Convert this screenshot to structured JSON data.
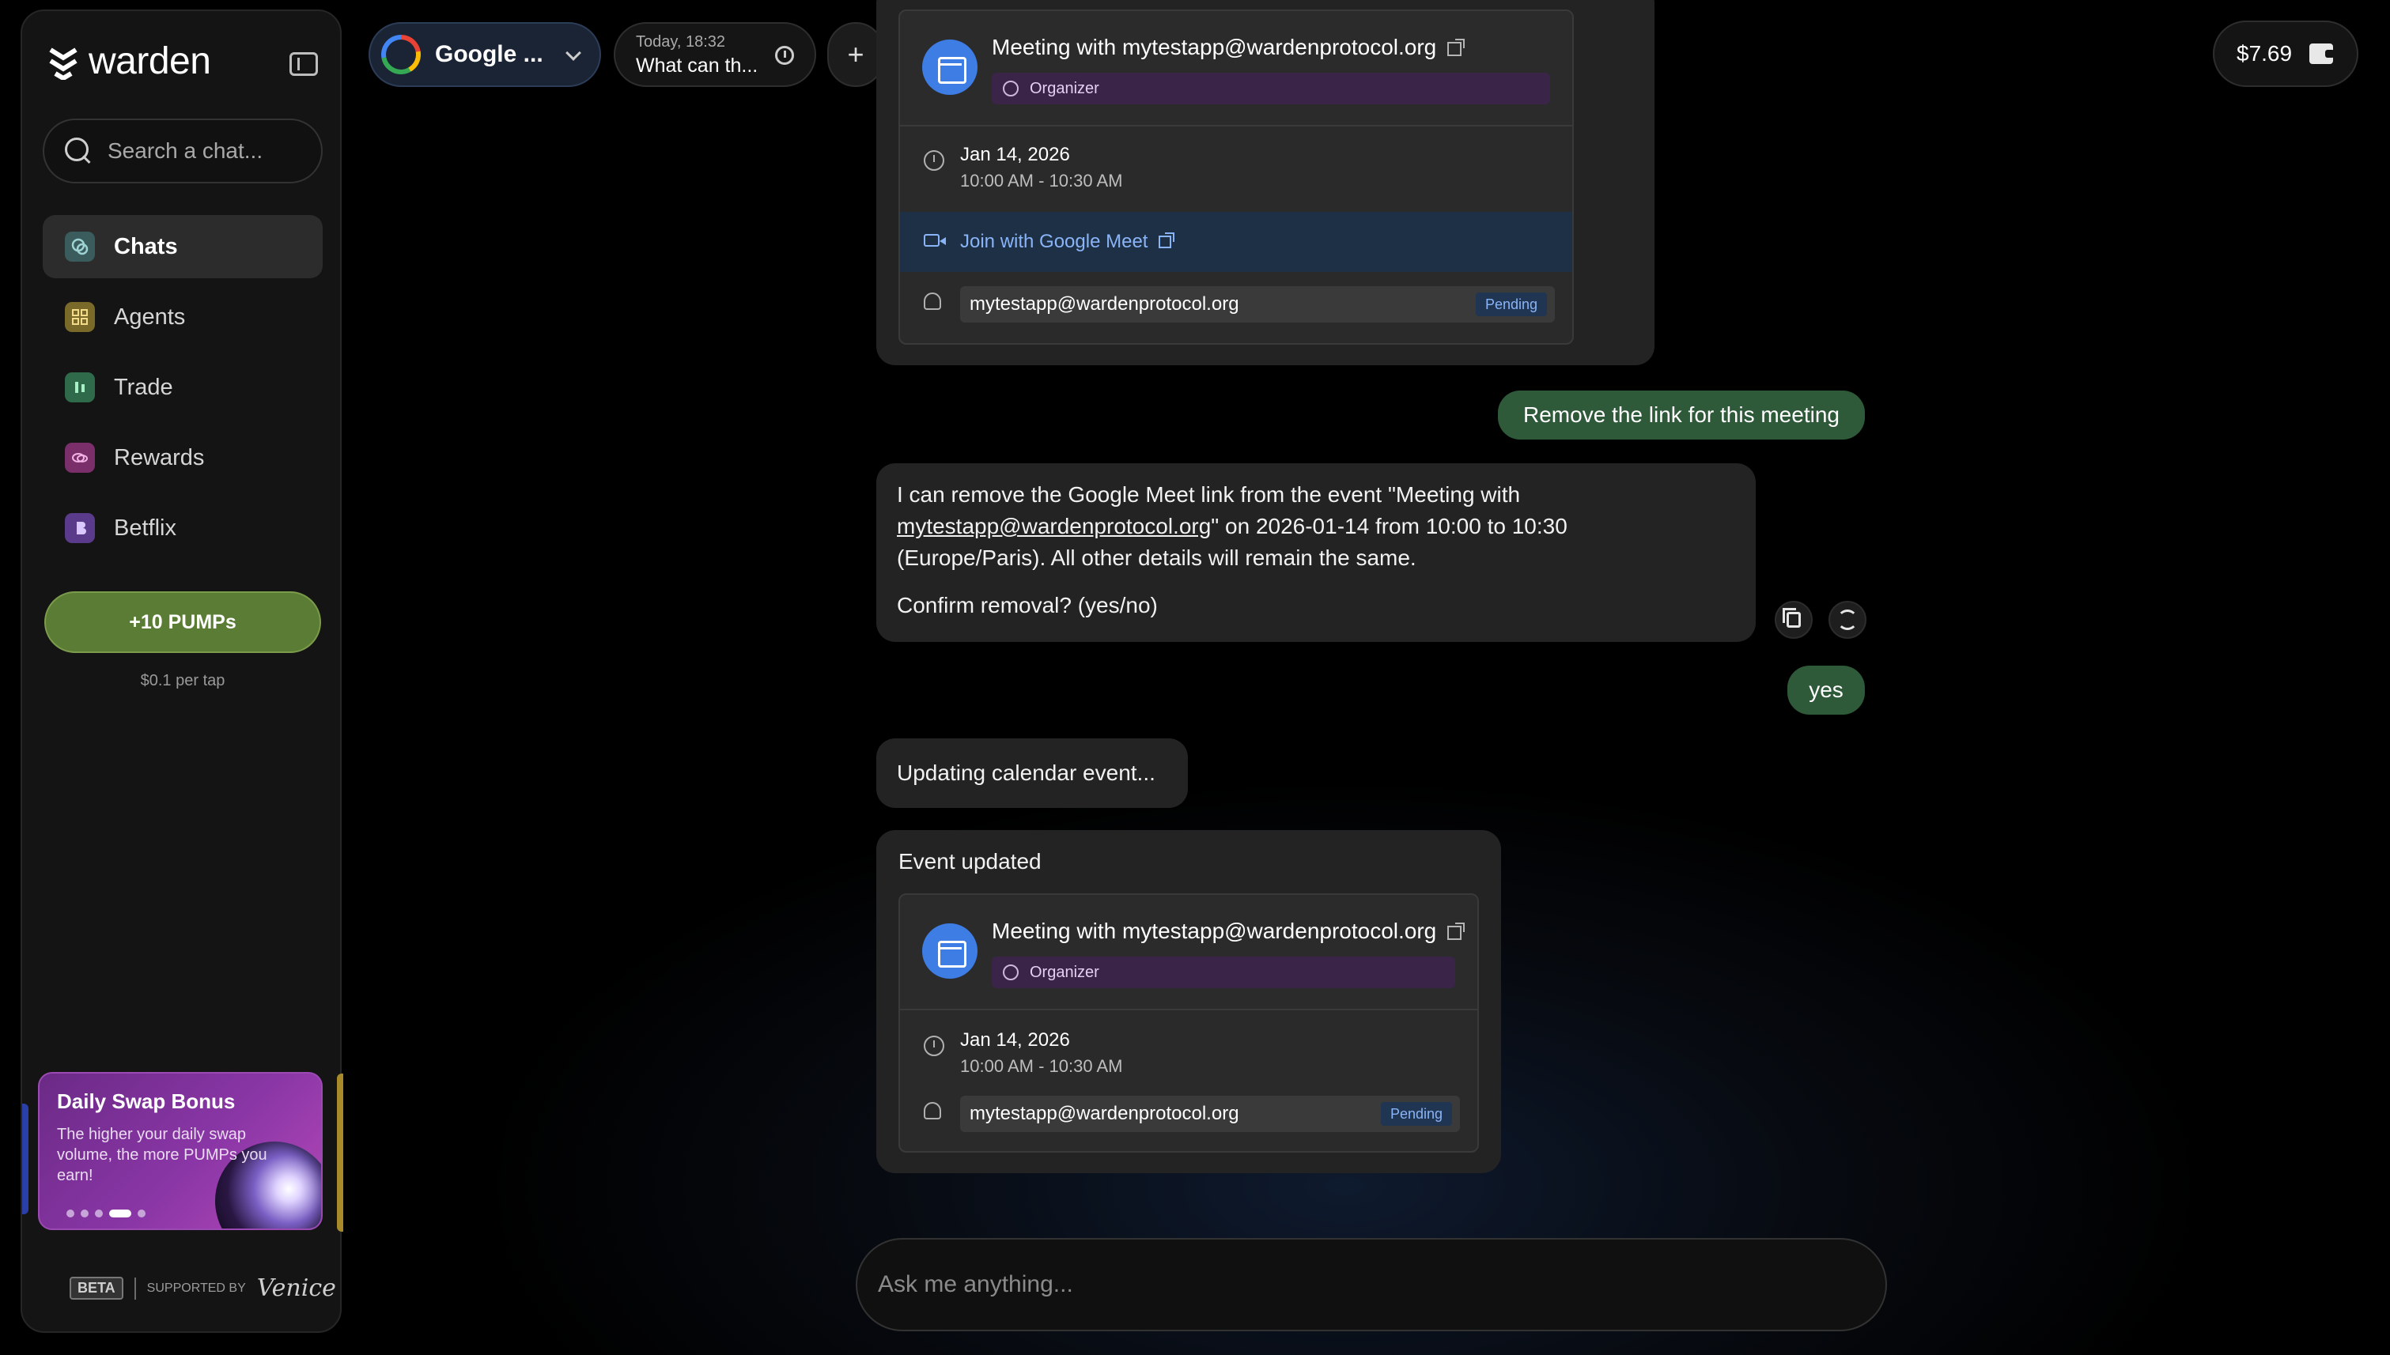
{
  "sidebar": {
    "logo_text": "warden",
    "search_placeholder": "Search a chat...",
    "nav": [
      {
        "label": "Chats",
        "icon": "chat-icon",
        "color": "#3a5c5c",
        "active": true
      },
      {
        "label": "Agents",
        "icon": "agents-icon",
        "color": "#7a6a2a"
      },
      {
        "label": "Trade",
        "icon": "trade-icon",
        "color": "#2f6a4a"
      },
      {
        "label": "Rewards",
        "icon": "rewards-icon",
        "color": "#7a2f6a"
      },
      {
        "label": "Betflix",
        "icon": "betflix-icon",
        "color": "#5a3a8a"
      }
    ],
    "pumps_button": "+10 PUMPs",
    "pumps_sub": "$0.1 per tap",
    "promo": {
      "title": "Daily Swap Bonus",
      "text": "The higher your daily swap volume, the more PUMPs you earn!"
    },
    "footer": {
      "beta": "BETA",
      "supported_by": "SUPPORTED BY",
      "partner": "Venice"
    }
  },
  "topbar": {
    "app_name": "Google ...",
    "chat_tab_time": "Today, 18:32",
    "chat_tab_title": "What can th...",
    "new_chat": "+",
    "balance": "$7.69"
  },
  "chat": {
    "card1": {
      "title": "Meeting with mytestapp@wardenprotocol.org",
      "role": "Organizer",
      "date": "Jan 14, 2026",
      "time": "10:00 AM - 10:30 AM",
      "meet_link": "Join with Google Meet",
      "attendee": "mytestapp@wardenprotocol.org",
      "status": "Pending"
    },
    "user_msg_1": "Remove the link for this meeting",
    "ai_msg_1": {
      "line1": "I can remove the Google Meet link from the event \"Meeting with",
      "link": "mytestapp@wardenprotocol.org",
      "line2_rest": "\" on 2026-01-14 from 10:00 to 10:30",
      "line3": "(Europe/Paris). All other details will remain the same.",
      "confirm": "Confirm removal? (yes/no)"
    },
    "user_msg_2": "yes",
    "ai_msg_2": "Updating calendar event...",
    "ai_msg_3_title": "Event updated",
    "card2": {
      "title": "Meeting with mytestapp@wardenprotocol.org",
      "role": "Organizer",
      "date": "Jan 14, 2026",
      "time": "10:00 AM - 10:30 AM",
      "attendee": "mytestapp@wardenprotocol.org",
      "status": "Pending"
    },
    "composer_placeholder": "Ask me anything..."
  }
}
